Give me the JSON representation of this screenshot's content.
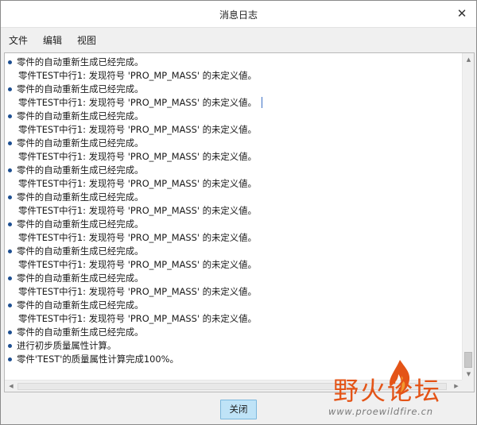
{
  "window": {
    "title": "消息日志",
    "close_glyph": "✕"
  },
  "menu": {
    "items": [
      "文件",
      "编辑",
      "视图"
    ]
  },
  "log": {
    "lines": [
      {
        "text": "零件的自动重新生成已经完成。",
        "bullet": true
      },
      {
        "text": "零件TEST中行1: 发现符号 'PRO_MP_MASS' 的未定义値。",
        "bullet": false
      },
      {
        "text": "零件的自动重新生成已经完成。",
        "bullet": true
      },
      {
        "text": "零件TEST中行1: 发现符号 'PRO_MP_MASS' 的未定义値。",
        "bullet": false,
        "caret": true
      },
      {
        "text": "零件的自动重新生成已经完成。",
        "bullet": true
      },
      {
        "text": "零件TEST中行1: 发现符号 'PRO_MP_MASS' 的未定义値。",
        "bullet": false
      },
      {
        "text": "零件的自动重新生成已经完成。",
        "bullet": true
      },
      {
        "text": "零件TEST中行1: 发现符号 'PRO_MP_MASS' 的未定义値。",
        "bullet": false
      },
      {
        "text": "零件的自动重新生成已经完成。",
        "bullet": true
      },
      {
        "text": "零件TEST中行1: 发现符号 'PRO_MP_MASS' 的未定义値。",
        "bullet": false
      },
      {
        "text": "零件的自动重新生成已经完成。",
        "bullet": true
      },
      {
        "text": "零件TEST中行1: 发现符号 'PRO_MP_MASS' 的未定义値。",
        "bullet": false
      },
      {
        "text": "零件的自动重新生成已经完成。",
        "bullet": true
      },
      {
        "text": "零件TEST中行1: 发现符号 'PRO_MP_MASS' 的未定义値。",
        "bullet": false
      },
      {
        "text": "零件的自动重新生成已经完成。",
        "bullet": true
      },
      {
        "text": "零件TEST中行1: 发现符号 'PRO_MP_MASS' 的未定义値。",
        "bullet": false
      },
      {
        "text": "零件的自动重新生成已经完成。",
        "bullet": true
      },
      {
        "text": "零件TEST中行1: 发现符号 'PRO_MP_MASS' 的未定义値。",
        "bullet": false
      },
      {
        "text": "零件的自动重新生成已经完成。",
        "bullet": true
      },
      {
        "text": "零件TEST中行1: 发现符号 'PRO_MP_MASS' 的未定义値。",
        "bullet": false
      },
      {
        "text": "零件的自动重新生成已经完成。",
        "bullet": true
      },
      {
        "text": "进行初步质量属性计算。",
        "bullet": true
      },
      {
        "text": "零件'TEST'的质量属性计算完成100%。",
        "bullet": true
      }
    ]
  },
  "footer": {
    "close_label": "关闭"
  },
  "watermark": {
    "title": "野火论坛",
    "url": "www.proewildfire.cn"
  },
  "colors": {
    "accent": "#bfe3f7",
    "bullet": "#1e4f91",
    "watermark": "#e45417"
  }
}
